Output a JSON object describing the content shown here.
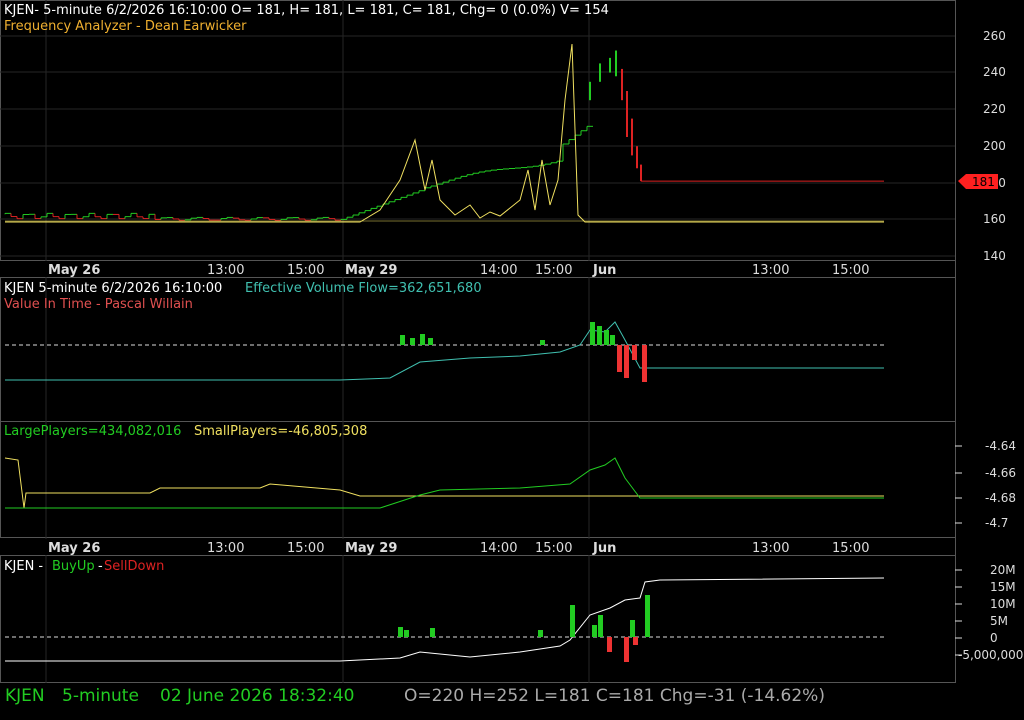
{
  "colors": {
    "bg": "#000000",
    "grid": "#2a2a2a",
    "up": "#22cc22",
    "down": "#dd2222",
    "yellow": "#f0e060",
    "orange": "#e08030",
    "teal": "#40c0b0",
    "white": "#ffffff",
    "last": "#ff2020"
  },
  "panel1": {
    "title": "KJEN- 5-minute 6/2/2026 16:10:00 O= 181, H= 181, L= 181, C= 181, Chg= 0 (0.0%) V= 154",
    "subtitle": "Frequency Analyzer - Dean Earwicker",
    "price_labels": [
      "260",
      "240",
      "220",
      "200",
      "180",
      "160",
      "140"
    ],
    "last_price": "181"
  },
  "panel2": {
    "title": "KJEN 5-minute  6/2/2026 16:10:00",
    "indicator": "Effective Volume Flow=362,651,680",
    "subtitle": "Value In Time - Pascal Willain"
  },
  "panel3": {
    "large": "LargePlayers=434,082,016",
    "small": "SmallPlayers=-46,805,308",
    "labels": [
      "-4.64",
      "-4.66",
      "-4.68",
      "-4.7"
    ]
  },
  "panel4": {
    "prefix": "KJEN - ",
    "buy": "BuyUp",
    "dash": "-",
    "sell": "SellDown",
    "labels": [
      "20M",
      "15M",
      "10M",
      "5M",
      "0",
      "-5,000,000"
    ]
  },
  "time_axis": [
    "May 26",
    "13:00",
    "15:00",
    "May 29",
    "14:00",
    "15:00",
    "Jun",
    "13:00",
    "15:00"
  ],
  "status": {
    "symbol": "KJEN",
    "interval": "5-minute",
    "datetime": "02 June 2026 18:32:40",
    "ohlc": "O=220  H=252  L=181  C=181  Chg=-31 (-14.62%)"
  }
}
